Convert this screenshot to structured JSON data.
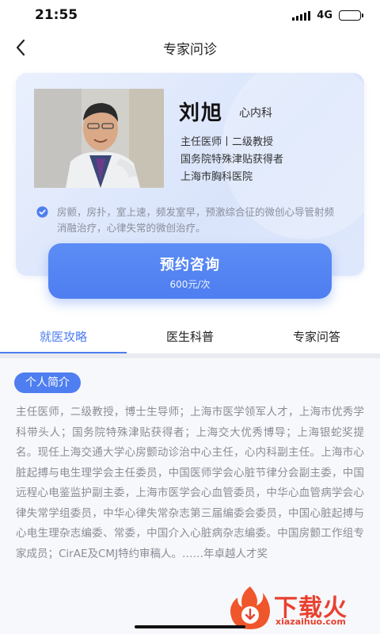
{
  "status_bar": {
    "time": "21:55",
    "network": "4G",
    "battery_level": 0.3
  },
  "nav": {
    "title": "专家问诊"
  },
  "doctor": {
    "name": "刘旭",
    "department": "心内科",
    "title_line": "主任医师丨二级教授",
    "honor_line": "国务院特殊津贴获得者",
    "hospital_line": "上海市胸科医院",
    "specialty": "房颤，房扑，室上速，频发室早，预激综合征的微创心导管射频消融治疗，心律失常的微创治疗。"
  },
  "booking": {
    "label": "预约咨询",
    "price": "600元/次"
  },
  "tabs": [
    {
      "label": "就医攻略",
      "active": true
    },
    {
      "label": "医生科普",
      "active": false
    },
    {
      "label": "专家问答",
      "active": false
    }
  ],
  "intro": {
    "chip": "个人简介",
    "text": "主任医师，二级教授，博士生导师；上海市医学领军人才，上海市优秀学科带头人；国务院特殊津贴获得者；上海交大优秀博导；上海银蛇奖提名。现任上海交通大学心房颤动诊治中心主任，心内科副主任。上海市心脏起搏与电生理学会主任委员，中国医师学会心脏节律分会副主委，中国远程心电鉴监护副主委，上海市医学会心血管委员，中华心血管病学会心律失常学组委员，中华心律失常杂志第三届编委会委员，中国心脏起搏与心电生理杂志编委、常委，中国介入心脏病杂志编委。中国房颤工作组专家成员；CirAE及CMJ特约审稿人。……年卓越人才奖"
  },
  "watermark": {
    "text": "下载火",
    "domain": "xiazaihuo.com"
  },
  "colors": {
    "accent": "#4e7ef0",
    "watermark": "#e8412f"
  }
}
